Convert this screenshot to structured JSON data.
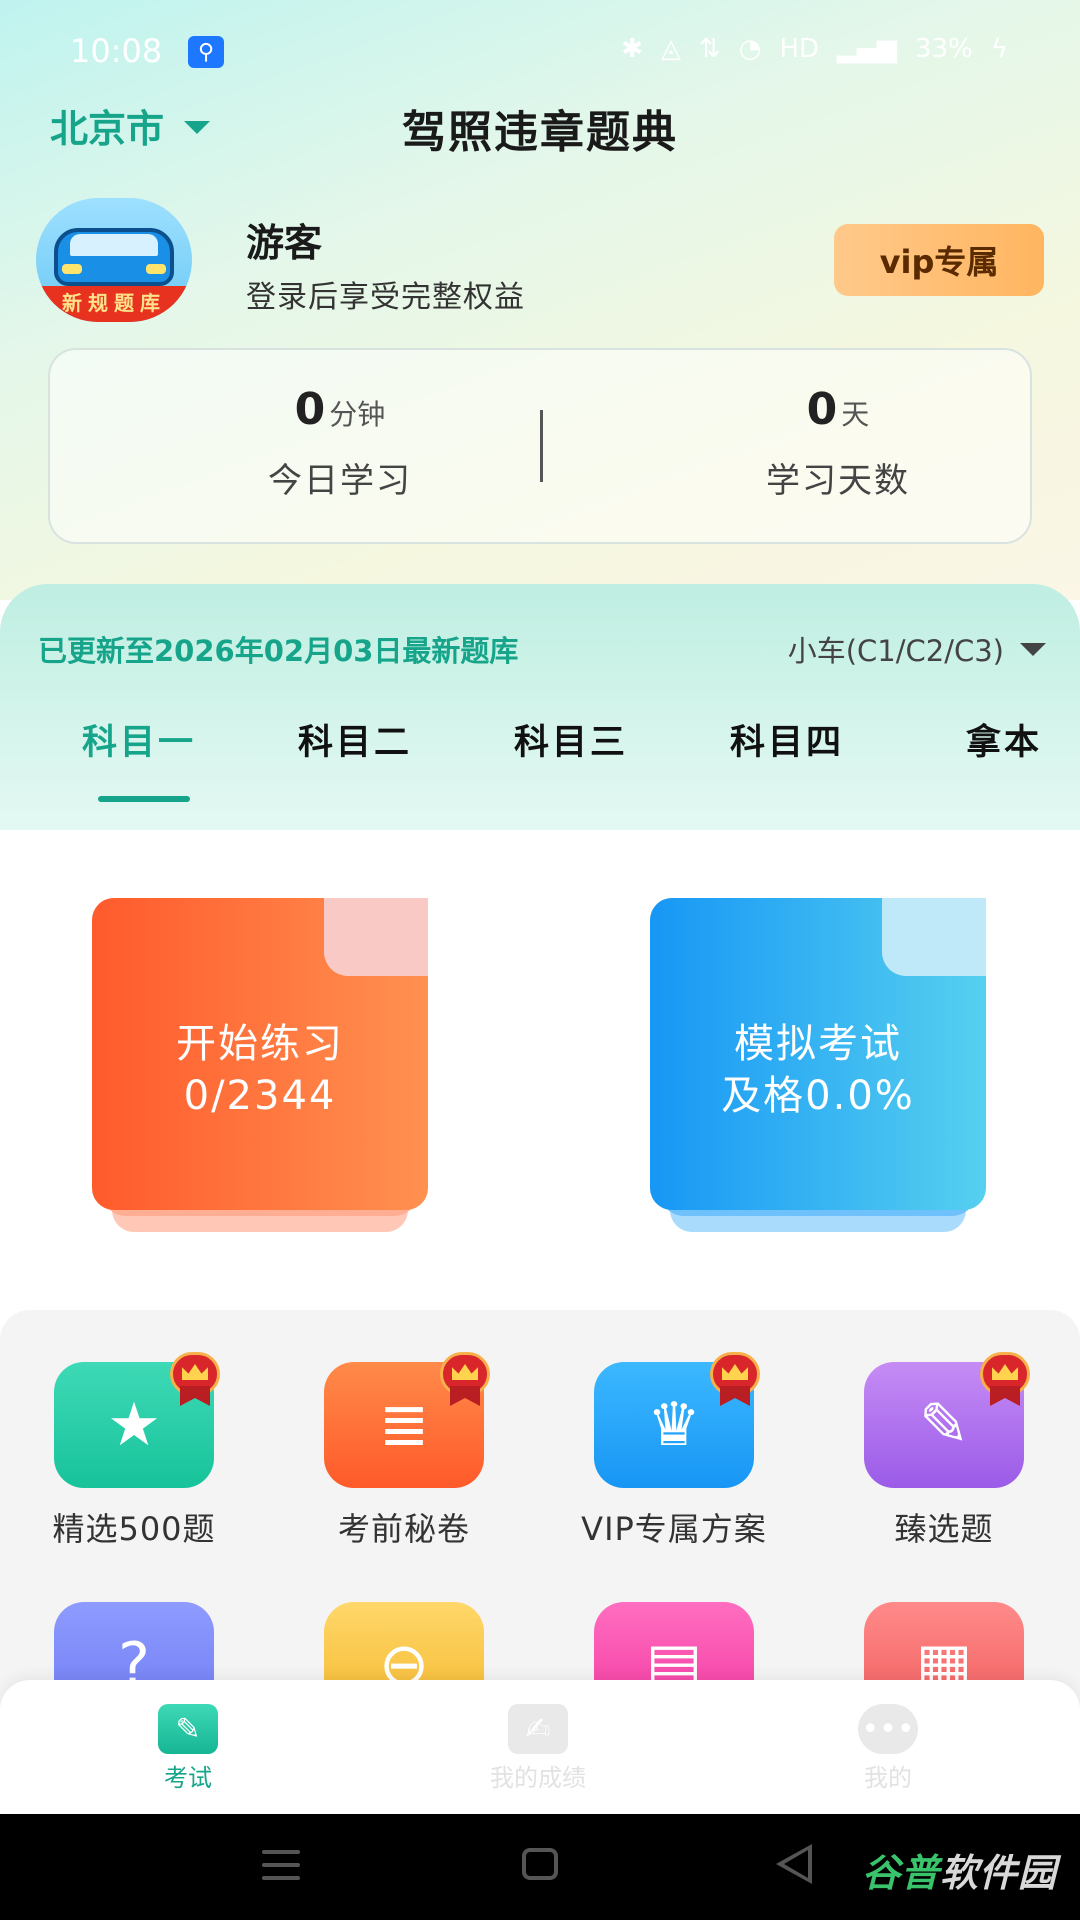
{
  "status_bar": {
    "time": "10:08",
    "network": "HD",
    "battery": "33%"
  },
  "header": {
    "city": "北京市",
    "title": "驾照违章题典"
  },
  "user": {
    "avatar_text": "新规题库",
    "name": "游客",
    "subtitle": "登录后享受完整权益",
    "vip_label": "vip专属"
  },
  "stats": {
    "today": {
      "value": "0",
      "unit": "分钟",
      "label": "今日学习"
    },
    "days": {
      "value": "0",
      "unit": "天",
      "label": "学习天数"
    }
  },
  "update": {
    "text": "已更新至2026年02月03日最新题库",
    "vehicle": "小车(C1/C2/C3)"
  },
  "tabs": [
    {
      "label": "科目一",
      "active": true
    },
    {
      "label": "科目二",
      "active": false
    },
    {
      "label": "科目三",
      "active": false
    },
    {
      "label": "科目四",
      "active": false
    },
    {
      "label": "拿本",
      "active": false
    }
  ],
  "cards": {
    "practice": {
      "line1": "开始练习",
      "line2": "0/2344"
    },
    "exam": {
      "line1": "模拟考试",
      "line2": "及格0.0%"
    }
  },
  "grid": [
    {
      "label": "精选500题",
      "icon": "star-icon",
      "vip": true
    },
    {
      "label": "考前秘卷",
      "icon": "scroll-icon",
      "vip": true
    },
    {
      "label": "VIP专属方案",
      "icon": "crown-icon",
      "vip": true
    },
    {
      "label": "臻选题",
      "icon": "edit-icon",
      "vip": true
    },
    {
      "label": "",
      "icon": "question-icon",
      "vip": false
    },
    {
      "label": "",
      "icon": "minus-icon",
      "vip": false
    },
    {
      "label": "",
      "icon": "notebook-icon",
      "vip": false
    },
    {
      "label": "",
      "icon": "grid-icon",
      "vip": false
    }
  ],
  "bottom_nav": [
    {
      "label": "考试",
      "icon": "pencil-icon",
      "active": true
    },
    {
      "label": "我的成绩",
      "icon": "report-icon",
      "active": false
    },
    {
      "label": "我的",
      "icon": "chat-icon",
      "active": false
    }
  ],
  "watermark": {
    "part1": "谷普",
    "part2": "软件园"
  },
  "colors": {
    "accent": "#16a58a",
    "practice_card": "#ff6a36",
    "exam_card": "#2aa8f3",
    "vip": "#ffb560"
  }
}
